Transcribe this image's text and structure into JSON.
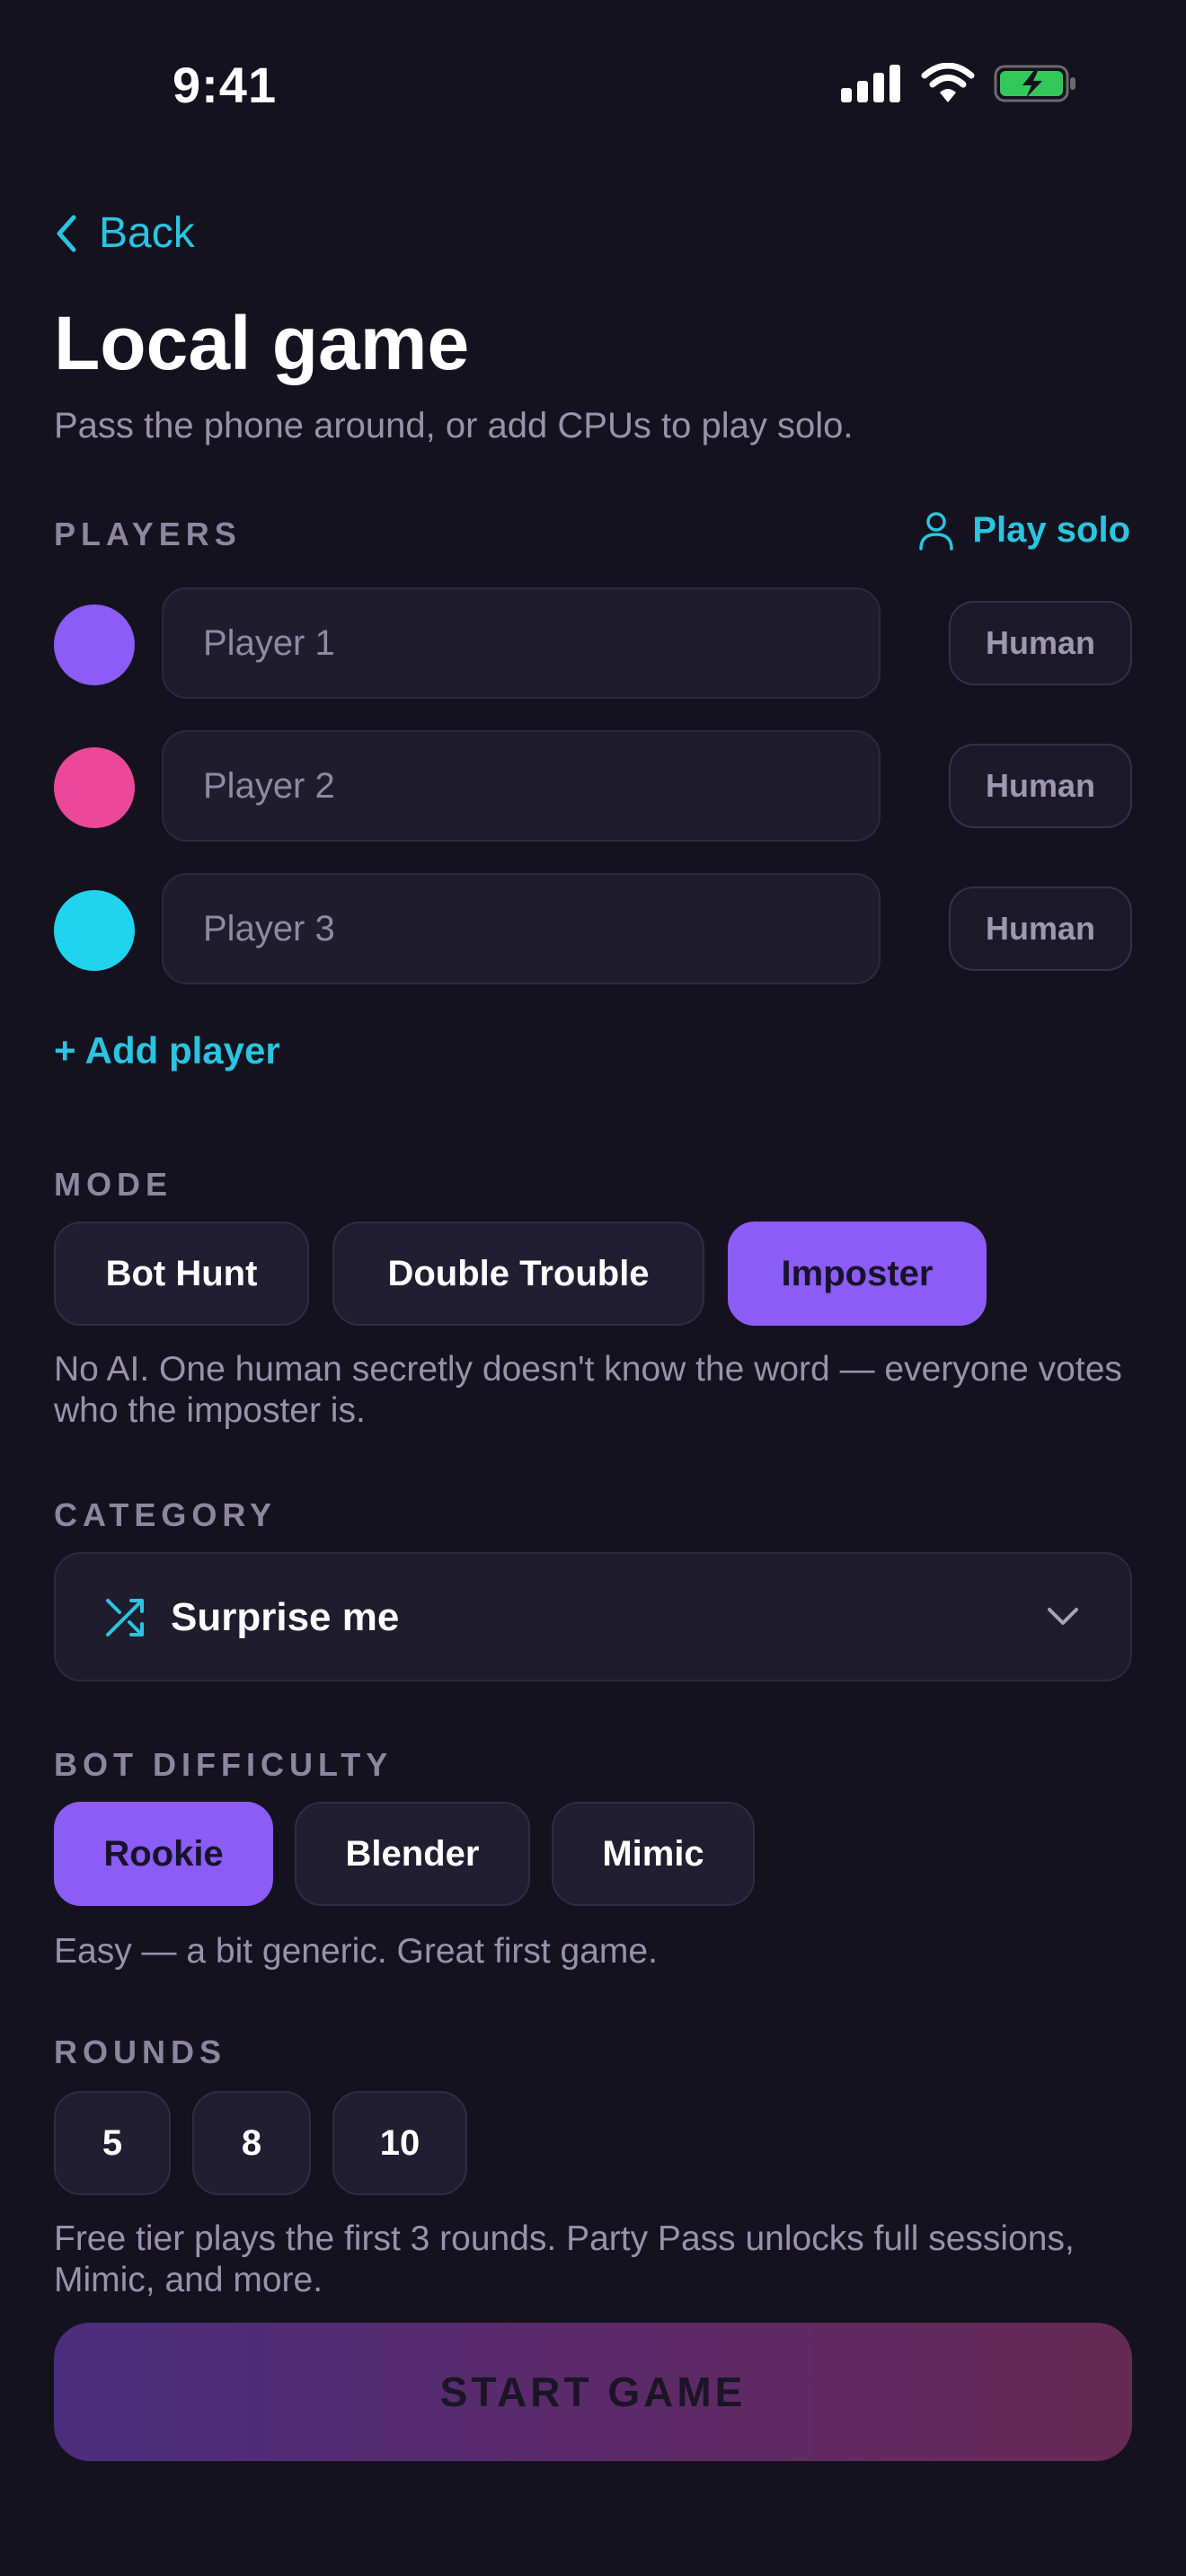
{
  "status_bar": {
    "time": "9:41"
  },
  "header": {
    "back_label": "Back",
    "title": "Local game",
    "subtitle": "Pass the phone around, or add CPUs to play solo."
  },
  "players": {
    "label": "PLAYERS",
    "play_solo_label": "Play solo",
    "rows": [
      {
        "placeholder": "Player 1",
        "type": "Human",
        "color": "#8b5cf6"
      },
      {
        "placeholder": "Player 2",
        "type": "Human",
        "color": "#ec4899"
      },
      {
        "placeholder": "Player 3",
        "type": "Human",
        "color": "#22d3ee"
      }
    ],
    "add_label": "+ Add player"
  },
  "mode": {
    "label": "MODE",
    "options": [
      "Bot Hunt",
      "Double Trouble",
      "Imposter"
    ],
    "selected": "Imposter",
    "description": "No AI. One human secretly doesn't know the word — everyone votes who the imposter is."
  },
  "category": {
    "label": "CATEGORY",
    "value": "Surprise me",
    "icon": "shuffle-icon"
  },
  "bot_difficulty": {
    "label": "BOT DIFFICULTY",
    "options": [
      "Rookie",
      "Blender",
      "Mimic"
    ],
    "selected": "Rookie",
    "description": "Easy — a bit generic. Great first game."
  },
  "rounds": {
    "label": "ROUNDS",
    "options": [
      "5",
      "8",
      "10"
    ],
    "note": "Free tier plays the first 3 rounds. Party Pass unlocks full sessions, Mimic, and more."
  },
  "start_label": "START GAME",
  "colors": {
    "accent": "#8b5cf6",
    "link": "#2bc4e0",
    "background": "#14121f"
  }
}
